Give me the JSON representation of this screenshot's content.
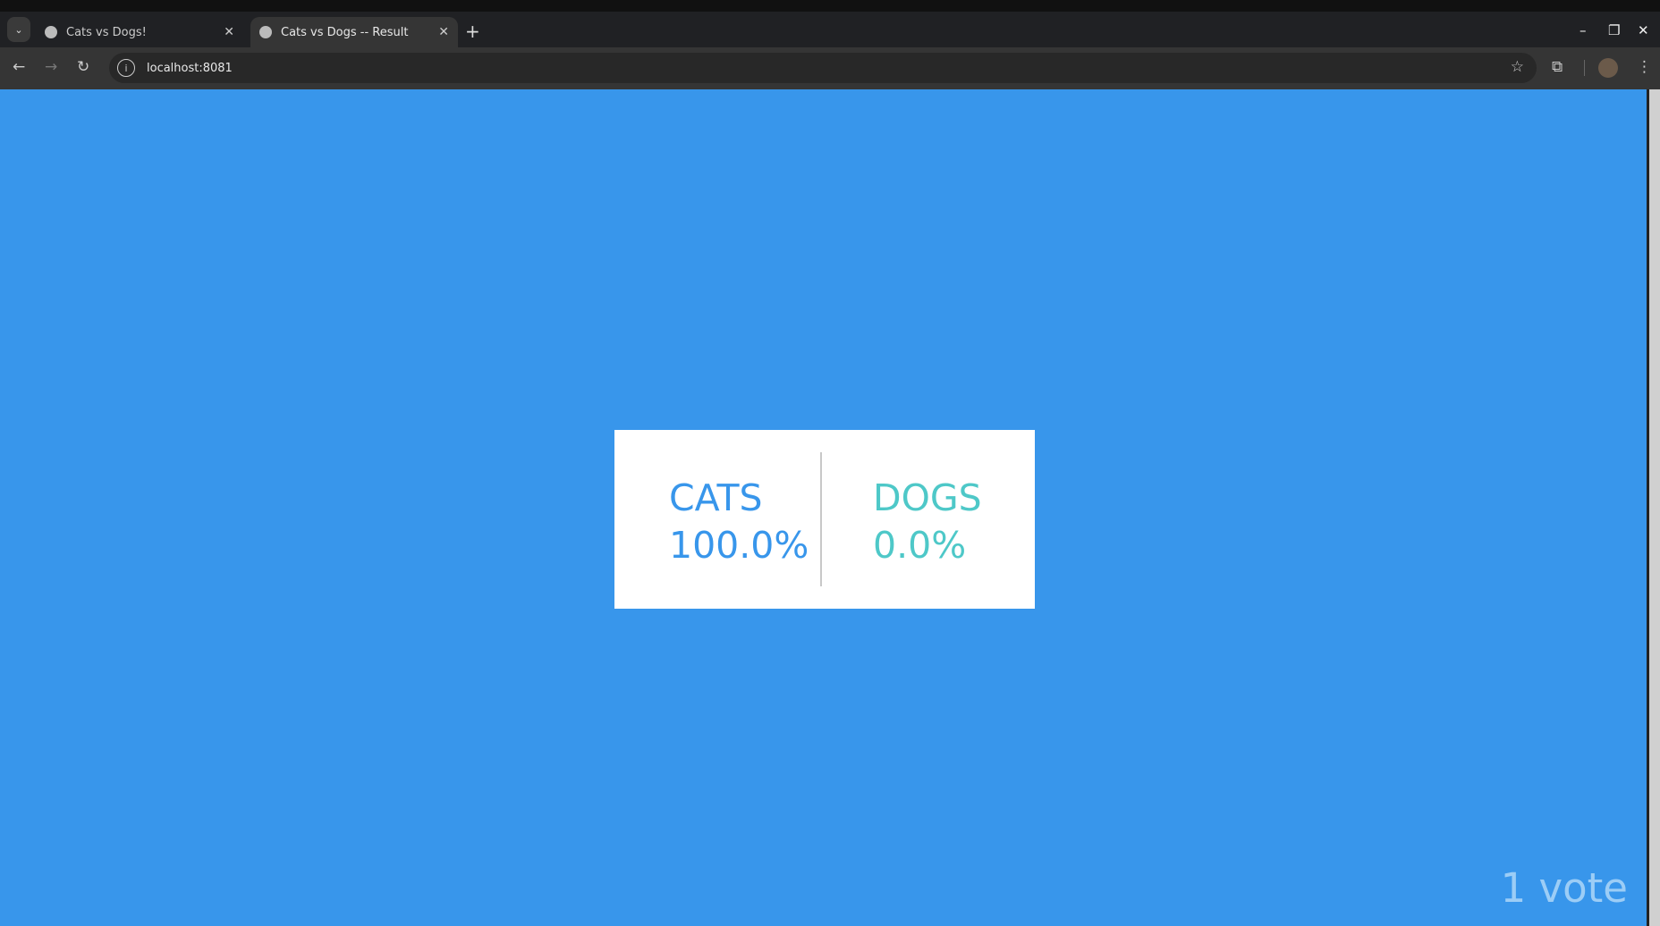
{
  "browser": {
    "tabs": [
      {
        "title": "Cats vs Dogs!",
        "active": false
      },
      {
        "title": "Cats vs Dogs -- Result",
        "active": true
      }
    ],
    "url": "localhost:8081"
  },
  "result": {
    "cats": {
      "label": "CATS",
      "percent": "100.0%",
      "color": "#3896eb"
    },
    "dogs": {
      "label": "DOGS",
      "percent": "0.0%",
      "color": "#4ec8c8"
    },
    "votes": "1 vote"
  },
  "colors": {
    "background": "#3896eb"
  }
}
